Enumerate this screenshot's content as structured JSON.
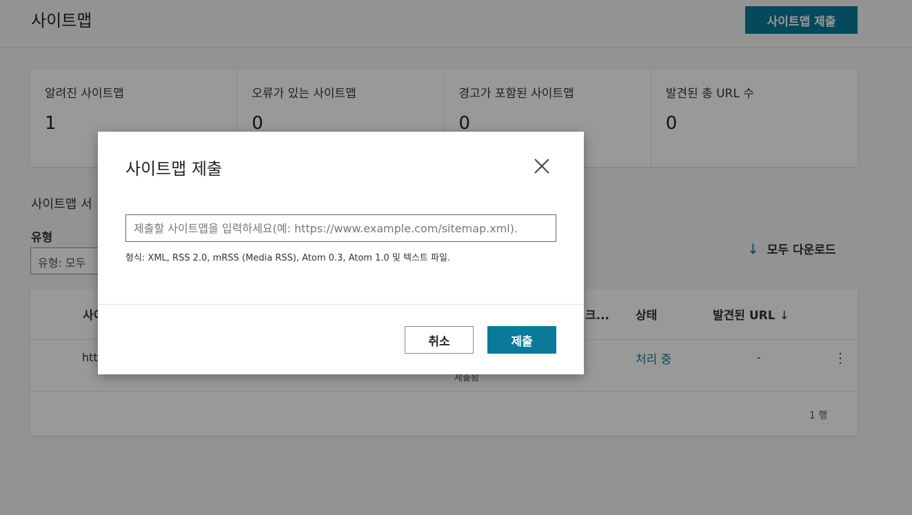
{
  "header": {
    "title": "사이트맵",
    "submit_label": "사이트맵 제출"
  },
  "stats": [
    {
      "label": "알려진 사이트맵",
      "value": "1"
    },
    {
      "label": "오류가 있는 사이트맵",
      "value": "0"
    },
    {
      "label": "경고가 포함된 사이트맵",
      "value": "0"
    },
    {
      "label": "발견된 총 URL 수",
      "value": "0"
    }
  ],
  "section": {
    "title": "사이트맵 서",
    "filter_label": "유형",
    "filter_value": "유형: 모두",
    "download_label": "모두 다운로드"
  },
  "table": {
    "headers": {
      "sitemap": "사이",
      "last_check": "크...",
      "status": "상태",
      "urls": "발견된 URL"
    },
    "rows": [
      {
        "url": "htt",
        "submitted": "제출됨",
        "status": "처리 중",
        "urls": "-"
      }
    ],
    "row_count": "1 행"
  },
  "modal": {
    "title": "사이트맵 제출",
    "input_placeholder": "제출할 사이트맵을 입력하세요(예: https://www.example.com/sitemap.xml).",
    "hint": "형식: XML, RSS 2.0, mRSS (Media RSS), Atom 0.3, Atom 1.0 및 텍스트 파일.",
    "cancel_label": "취소",
    "submit_label": "제출"
  },
  "colors": {
    "accent": "#0b7a99",
    "overlay": "rgba(0,0,0,0.4)"
  }
}
